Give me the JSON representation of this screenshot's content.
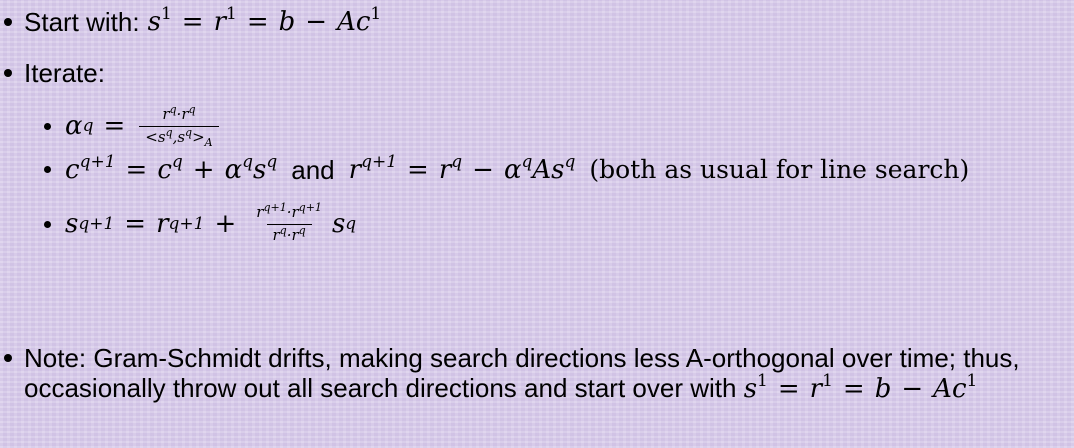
{
  "bullets": {
    "start_label": "Start with:",
    "iterate_label": "Iterate:",
    "usual_note": "(both as usual for line search)",
    "and_word": "and"
  },
  "note": {
    "text": "Note: Gram-Schmidt drifts, making search directions less A-orthogonal over time; thus, occasionally throw out all search directions and start over with"
  }
}
